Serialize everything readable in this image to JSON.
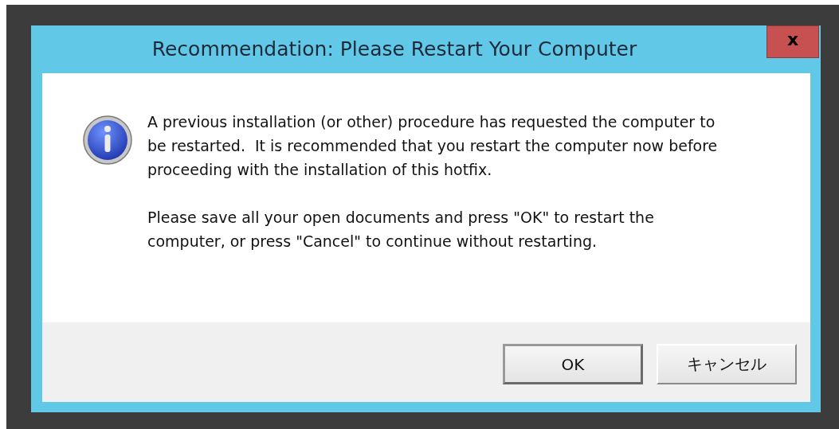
{
  "window": {
    "title": "Recommendation: Please Restart Your Computer",
    "close": "x"
  },
  "message": {
    "paragraphs": [
      "A previous installation (or other) procedure has requested the computer to be restarted.  It is recommended that you restart the computer now before proceeding with the installation of this hotfix.",
      "Please save all your open documents and press \"OK\" to restart the computer, or press \"Cancel\" to continue without restarting."
    ]
  },
  "buttons": [
    {
      "label": "OK",
      "default": true
    },
    {
      "label": "キャンセル",
      "default": false
    }
  ]
}
